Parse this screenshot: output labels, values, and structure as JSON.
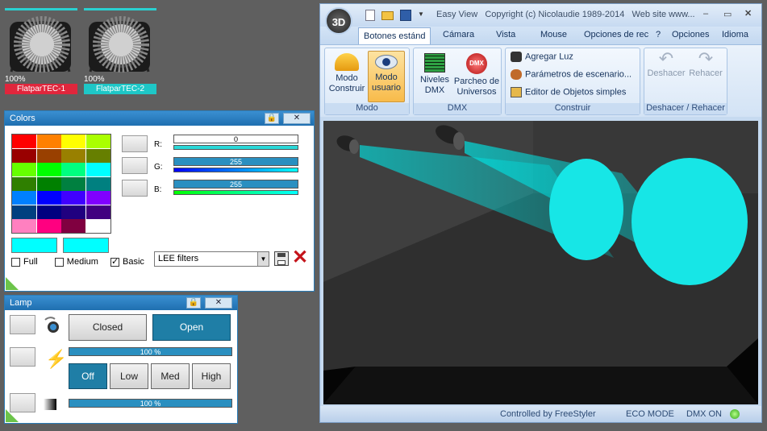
{
  "fixtures": [
    {
      "percent": "100%",
      "label": "FlatparTEC-1",
      "label_color": "#e0263c"
    },
    {
      "percent": "100%",
      "label": "FlatparTEC-2",
      "label_color": "#1ec7c7"
    }
  ],
  "colors_panel": {
    "title": "Colors",
    "palette": [
      "#ff0000",
      "#ff8000",
      "#ffff00",
      "#aaff00",
      "#990000",
      "#994000",
      "#998000",
      "#667f00",
      "#66ff00",
      "#00ff00",
      "#00ff80",
      "#00ffff",
      "#2f7f00",
      "#008000",
      "#008040",
      "#008080",
      "#0080ff",
      "#0000ff",
      "#4000ff",
      "#8000ff",
      "#004080",
      "#000080",
      "#200080",
      "#400080",
      "#ff80c0",
      "#ff0080",
      "#800040",
      "#ffffff"
    ],
    "current_color": "#00ffff",
    "rgb": [
      {
        "label": "R:",
        "value": "0"
      },
      {
        "label": "G:",
        "value": "255"
      },
      {
        "label": "B:",
        "value": "255"
      }
    ],
    "options": [
      {
        "label": "Full",
        "checked": false
      },
      {
        "label": "Medium",
        "checked": false
      },
      {
        "label": "Basic",
        "checked": true
      }
    ],
    "filter_select": "LEE filters"
  },
  "lamp_panel": {
    "title": "Lamp",
    "closed_label": "Closed",
    "open_label": "Open",
    "dimmer_value": "100 %",
    "modes": [
      "Off",
      "Low",
      "Med",
      "High"
    ],
    "second_value": "100 %"
  },
  "window": {
    "title": "Easy View   Copyright (c) Nicolaudie 1989-2014   Web site www...",
    "tabs": [
      "Botones estánd",
      "Cámara",
      "Vista",
      "Mouse",
      "Opciones de rec"
    ],
    "right_menus": [
      "?",
      "Opciones",
      "Idioma"
    ],
    "groups": {
      "modo": {
        "label": "Modo",
        "buttons": [
          "Modo\nConstruir",
          "Modo\nusuario"
        ]
      },
      "dmx": {
        "label": "DMX",
        "buttons": [
          "Niveles\nDMX",
          "Parcheo de\nUniversos"
        ]
      },
      "construir": {
        "label": "Construir",
        "items": [
          "Agregar Luz",
          "Parámetros de escenario...",
          "Editor de Objetos simples"
        ]
      },
      "deshacer": {
        "label": "Deshacer / Rehacer",
        "buttons": [
          "Deshacer",
          "Rehacer"
        ]
      }
    },
    "status": {
      "controlled": "Controlled by FreeStyler",
      "eco": "ECO MODE",
      "dmx": "DMX ON"
    }
  },
  "colors": {
    "accent": "#1f7ea6",
    "beam": "#00e5e5"
  }
}
